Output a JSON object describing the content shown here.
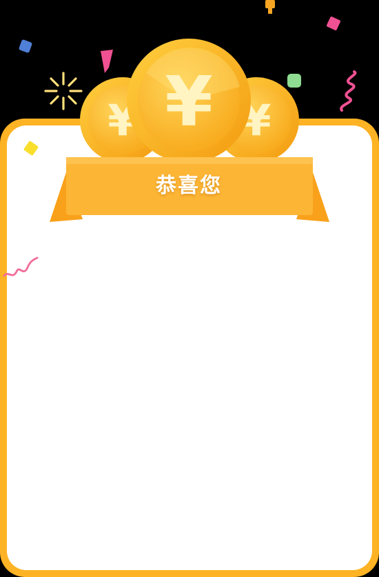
{
  "dialog": {
    "title": "恭喜您",
    "coin_symbol": "¥"
  },
  "colors": {
    "frame": "#fdb324",
    "panel": "#ffffff",
    "backdrop": "#000000",
    "coin": "#fbbf2a",
    "ribbon": "#fdb535"
  },
  "icons": {
    "coins": "gold-yuan-coin-icon",
    "confetti": "confetti-icon",
    "sparkle": "sparkle-icon"
  }
}
